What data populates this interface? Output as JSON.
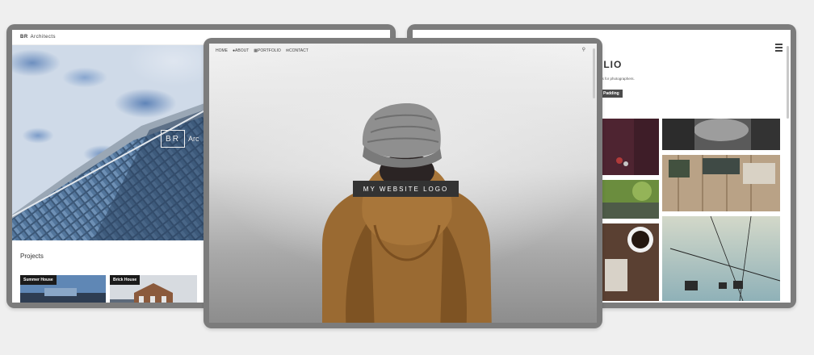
{
  "left_site": {
    "brand_short": "BR",
    "brand_name": "Architects",
    "hero_logo": "BR",
    "hero_word": "Arc",
    "section_title": "Projects",
    "thumbs": [
      {
        "label": "Summer House"
      },
      {
        "label": "Brick House"
      }
    ]
  },
  "center_site": {
    "nav": [
      {
        "icon": "home-icon",
        "label": "HOME"
      },
      {
        "icon": "user-icon",
        "label": "ABOUT"
      },
      {
        "icon": "grid-icon",
        "label": "PORTFOLIO"
      },
      {
        "icon": "mail-icon",
        "label": "CONTACT"
      }
    ],
    "logo_text": "MY WEBSITE LOGO"
  },
  "right_site": {
    "title": "OLIO",
    "subtitle": "es for photographers.",
    "button": "Padding"
  },
  "colors": {
    "frame": "#7c7c7c",
    "background": "#efefef",
    "logo_bg": "#333333",
    "coat": "#9a6a32"
  }
}
